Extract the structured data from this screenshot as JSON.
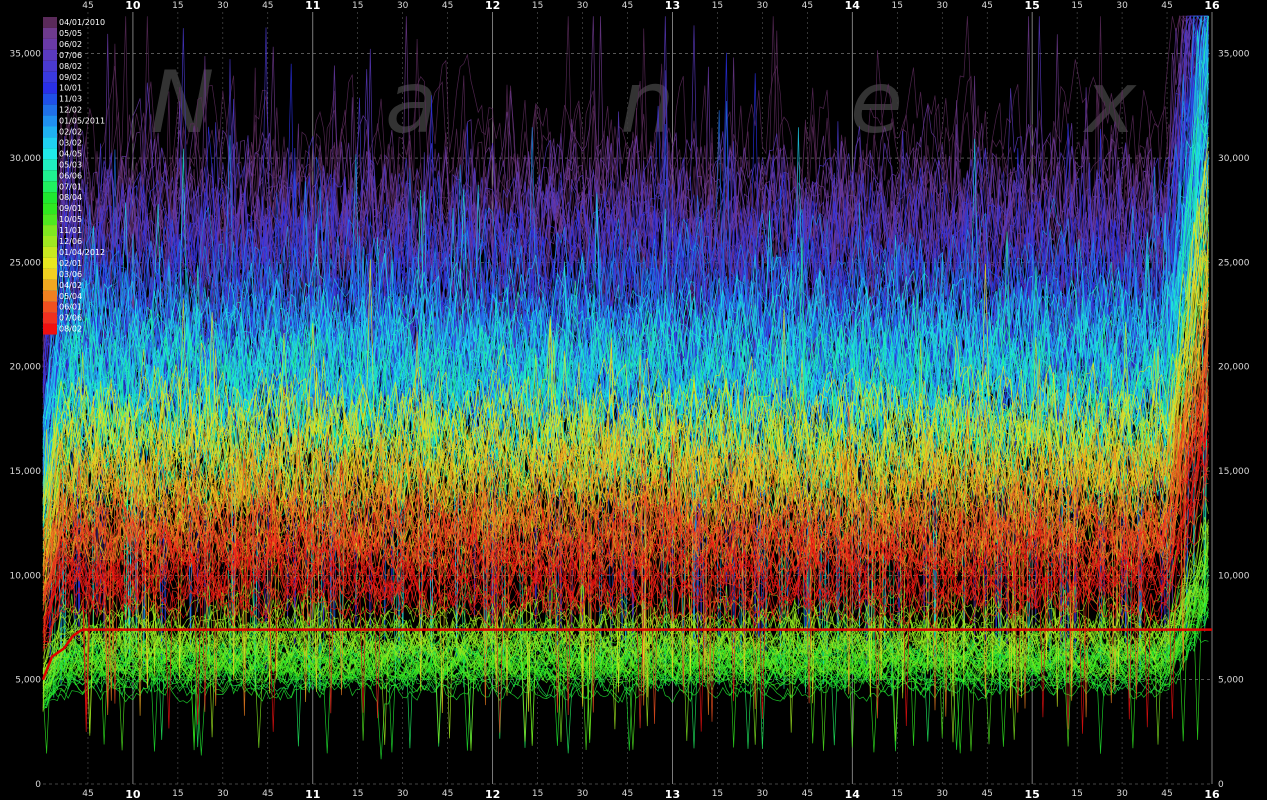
{
  "chart_data": {
    "type": "line",
    "title": "",
    "xlabel": "",
    "ylabel": "",
    "watermark": [
      "N",
      "a",
      "n",
      "e",
      "x"
    ],
    "y_range": [
      0,
      37000
    ],
    "y_ticks": [
      {
        "value": 0,
        "label": "0"
      },
      {
        "value": 5000,
        "label": "5,000"
      },
      {
        "value": 10000,
        "label": "10,000"
      },
      {
        "value": 15000,
        "label": "15,000"
      },
      {
        "value": 20000,
        "label": "20,000"
      },
      {
        "value": 25000,
        "label": "25,000"
      },
      {
        "value": 30000,
        "label": "30,000"
      },
      {
        "value": 35000,
        "label": "35,000"
      }
    ],
    "x_range_minutes": [
      570,
      960
    ],
    "x_ticks": [
      {
        "minute": 585,
        "label": "45",
        "hour": false
      },
      {
        "minute": 600,
        "label": "10",
        "hour": true
      },
      {
        "minute": 615,
        "label": "15",
        "hour": false
      },
      {
        "minute": 630,
        "label": "30",
        "hour": false
      },
      {
        "minute": 645,
        "label": "45",
        "hour": false
      },
      {
        "minute": 660,
        "label": "11",
        "hour": true
      },
      {
        "minute": 675,
        "label": "15",
        "hour": false
      },
      {
        "minute": 690,
        "label": "30",
        "hour": false
      },
      {
        "minute": 705,
        "label": "45",
        "hour": false
      },
      {
        "minute": 720,
        "label": "12",
        "hour": true
      },
      {
        "minute": 735,
        "label": "15",
        "hour": false
      },
      {
        "minute": 750,
        "label": "30",
        "hour": false
      },
      {
        "minute": 765,
        "label": "45",
        "hour": false
      },
      {
        "minute": 780,
        "label": "13",
        "hour": true
      },
      {
        "minute": 795,
        "label": "15",
        "hour": false
      },
      {
        "minute": 810,
        "label": "30",
        "hour": false
      },
      {
        "minute": 825,
        "label": "45",
        "hour": false
      },
      {
        "minute": 840,
        "label": "14",
        "hour": true
      },
      {
        "minute": 855,
        "label": "15",
        "hour": false
      },
      {
        "minute": 870,
        "label": "30",
        "hour": false
      },
      {
        "minute": 885,
        "label": "45",
        "hour": false
      },
      {
        "minute": 900,
        "label": "15",
        "hour": true
      },
      {
        "minute": 915,
        "label": "15",
        "hour": false
      },
      {
        "minute": 930,
        "label": "30",
        "hour": false
      },
      {
        "minute": 945,
        "label": "45",
        "hour": false
      },
      {
        "minute": 960,
        "label": "16",
        "hour": true
      }
    ],
    "legend": [
      {
        "label": "04/01/2010",
        "color": "#5a2a5a",
        "base": 26000
      },
      {
        "label": "05/05",
        "color": "#6e3a8e",
        "base": 25000
      },
      {
        "label": "06/02",
        "color": "#6a3aa8",
        "base": 24500
      },
      {
        "label": "07/06",
        "color": "#5a3ac0",
        "base": 23500
      },
      {
        "label": "08/02",
        "color": "#4a3ad0",
        "base": 23000
      },
      {
        "label": "09/02",
        "color": "#3a3ae0",
        "base": 22500
      },
      {
        "label": "10/01",
        "color": "#2a30e8",
        "base": 22000
      },
      {
        "label": "11/03",
        "color": "#2050e8",
        "base": 21500
      },
      {
        "label": "12/02",
        "color": "#2070e8",
        "base": 21000
      },
      {
        "label": "01/05/2011",
        "color": "#2090f0",
        "base": 20500
      },
      {
        "label": "02/02",
        "color": "#20b0f0",
        "base": 20000
      },
      {
        "label": "03/02",
        "color": "#20d0f0",
        "base": 19500
      },
      {
        "label": "04/05",
        "color": "#20e8e8",
        "base": 19000
      },
      {
        "label": "05/03",
        "color": "#20f0c0",
        "base": 18000
      },
      {
        "label": "06/06",
        "color": "#20f090",
        "base": 17000
      },
      {
        "label": "07/01",
        "color": "#20f060",
        "base": 6000
      },
      {
        "label": "08/04",
        "color": "#20e830",
        "base": 5200
      },
      {
        "label": "09/01",
        "color": "#30e820",
        "base": 5600
      },
      {
        "label": "10/05",
        "color": "#50e820",
        "base": 6200
      },
      {
        "label": "11/01",
        "color": "#80e820",
        "base": 6800
      },
      {
        "label": "12/06",
        "color": "#a0e820",
        "base": 7500
      },
      {
        "label": "01/04/2012",
        "color": "#c8e820",
        "base": 15000
      },
      {
        "label": "02/01",
        "color": "#e8e820",
        "base": 15500
      },
      {
        "label": "03/06",
        "color": "#f0d020",
        "base": 14500
      },
      {
        "label": "04/02",
        "color": "#f0a820",
        "base": 13500
      },
      {
        "label": "05/04",
        "color": "#f08020",
        "base": 12500
      },
      {
        "label": "06/01",
        "color": "#f05020",
        "base": 11500
      },
      {
        "label": "07/06",
        "color": "#f03020",
        "base": 10500
      },
      {
        "label": "08/02",
        "color": "#f01010",
        "base": 10000
      }
    ],
    "reference_line": {
      "value": 7400,
      "color": "#e00000"
    },
    "series_shape": "one line per trading day (Apr 2010 – Aug 2012), colored by date per legend; individual daily values are not printed"
  }
}
